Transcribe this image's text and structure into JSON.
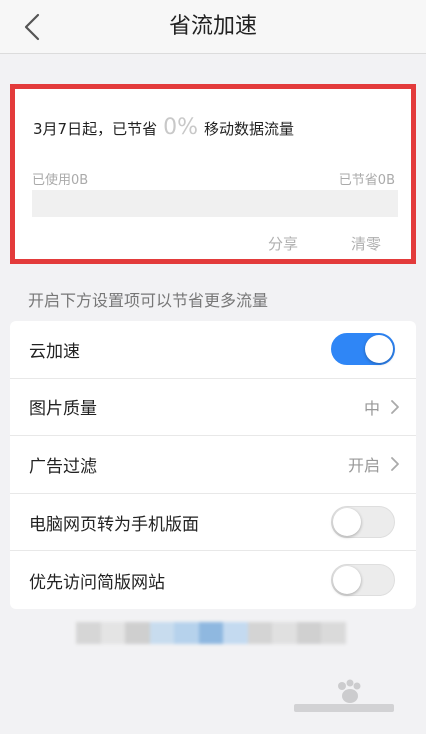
{
  "nav": {
    "title": "省流加速"
  },
  "stats": {
    "headline_prefix": "3月7日起，已节省",
    "percent": "0%",
    "headline_suffix": "移动数据流量",
    "used_label": "已使用0B",
    "saved_label": "已节省0B",
    "saved_fraction": 0,
    "share_label": "分享",
    "clear_label": "清零"
  },
  "hint": "开启下方设置项可以节省更多流量",
  "settings": {
    "items": [
      {
        "label": "云加速",
        "type": "toggle",
        "on": true
      },
      {
        "label": "图片质量",
        "type": "select",
        "value": "中"
      },
      {
        "label": "广告过滤",
        "type": "select",
        "value": "开启"
      },
      {
        "label": "电脑网页转为手机版面",
        "type": "toggle",
        "on": false
      },
      {
        "label": "优先访问简版网站",
        "type": "toggle",
        "on": false
      }
    ]
  },
  "colors": {
    "highlight_border": "#e33b3b",
    "toggle_on": "#2f86f6",
    "background": "#f2f2f4"
  },
  "icons": {
    "back": "chevron-left-icon",
    "row_arrow": "chevron-right-icon"
  }
}
